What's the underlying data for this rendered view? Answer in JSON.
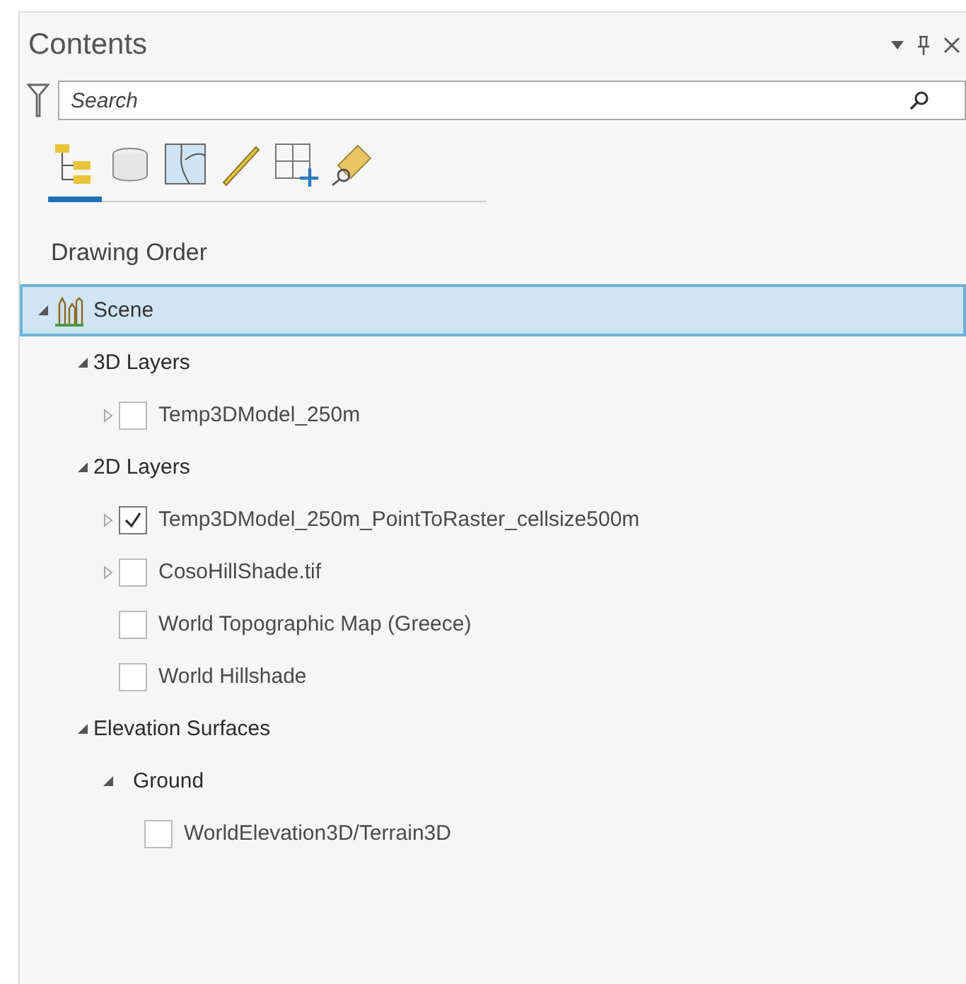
{
  "panel": {
    "title": "Contents"
  },
  "search": {
    "placeholder": "Search"
  },
  "tabs": [
    {
      "selected": true
    },
    {
      "selected": false
    },
    {
      "selected": false
    },
    {
      "selected": false
    },
    {
      "selected": false
    },
    {
      "selected": false
    }
  ],
  "section_title": "Drawing Order",
  "tree": [
    {
      "kind": "map",
      "label": "Scene",
      "expanded": true,
      "selected": true,
      "children": [
        {
          "kind": "group",
          "label": "3D Layers",
          "expanded": true,
          "selected": false,
          "children": [
            {
              "kind": "layer",
              "label": "Temp3DModel_250m",
              "expanded": false,
              "checked": false,
              "selected": false
            }
          ]
        },
        {
          "kind": "group",
          "label": "2D Layers",
          "expanded": true,
          "selected": false,
          "children": [
            {
              "kind": "layer",
              "label": "Temp3DModel_250m_PointToRaster_cellsize500m",
              "expanded": false,
              "checked": true,
              "selected": false
            },
            {
              "kind": "layer",
              "label": "CosoHillShade.tif",
              "expanded": false,
              "checked": false,
              "selected": false
            },
            {
              "kind": "layer",
              "label": "World Topographic Map (Greece)",
              "checked": false,
              "selected": false
            },
            {
              "kind": "layer",
              "label": "World Hillshade",
              "checked": false,
              "selected": false
            }
          ]
        },
        {
          "kind": "group",
          "label": "Elevation Surfaces",
          "expanded": true,
          "selected": false,
          "children": [
            {
              "kind": "group",
              "label": "Ground",
              "expanded": true,
              "selected": false,
              "children": [
                {
                  "kind": "layer",
                  "label": "WorldElevation3D/Terrain3D",
                  "checked": false,
                  "selected": false
                }
              ]
            }
          ]
        }
      ]
    }
  ]
}
